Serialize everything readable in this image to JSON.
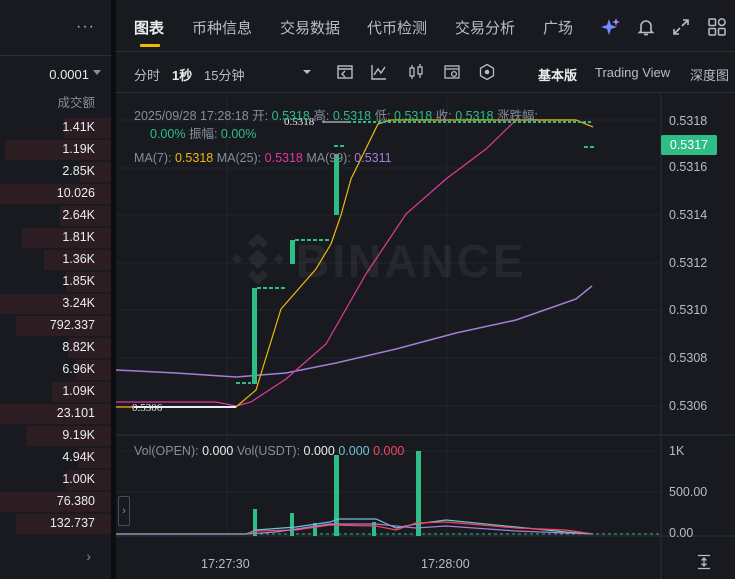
{
  "orderbook": {
    "menu_glyph": "···",
    "precision": "0.0001",
    "volume_header": "成交额",
    "rows": [
      "1.41K",
      "1.19K",
      "2.85K",
      "10.026",
      "2.64K",
      "1.81K",
      "1.36K",
      "1.85K",
      "3.24K",
      "792.337",
      "8.82K",
      "6.96K",
      "1.09K",
      "23.101",
      "9.19K",
      "4.94K",
      "1.00K",
      "76.380",
      "132.737"
    ],
    "more_glyph": "›"
  },
  "tabs": [
    "图表",
    "币种信息",
    "交易数据",
    "代币检测",
    "交易分析",
    "广场"
  ],
  "active_tab": "图表",
  "header_icons": [
    "ai-sparkle-icon",
    "bell-icon",
    "fullscreen-icon",
    "grid-icon"
  ],
  "toolbar": {
    "intervals": [
      "分时",
      "1秒",
      "15分钟"
    ],
    "active_interval": "1秒",
    "views": [
      "基本版",
      "Trading View",
      "深度图"
    ],
    "active_view": "基本版"
  },
  "ohlc": {
    "datetime": "2025/09/28 17:28:18",
    "open_label": "开:",
    "open": "0.5318",
    "high_label": "高:",
    "high": "0.5318",
    "low_label": "低:",
    "low": "0.5318",
    "close_label": "收:",
    "close": "0.5318",
    "change_label": "涨跌幅:",
    "change": "0.00%",
    "amplitude_label": "振幅:",
    "amplitude": "0.00%"
  },
  "ma": {
    "ma7_label": "MA(7):",
    "ma7": "0.5318",
    "ma25_label": "MA(25):",
    "ma25": "0.5318",
    "ma99_label": "MA(99):",
    "ma99": "0.5311"
  },
  "vol": {
    "open_label": "Vol(OPEN):",
    "open_value": "0.000",
    "usdt_label": "Vol(USDT):",
    "usdt_value": "0.000",
    "usdt_value2": "0.000",
    "usdt_value3": "0.000"
  },
  "current_price": "0.5317",
  "price_axis": [
    "0.5318",
    "0.5316",
    "0.5314",
    "0.5312",
    "0.5310",
    "0.5308",
    "0.5306"
  ],
  "volume_axis": [
    "1K",
    "500.00",
    "0.00"
  ],
  "time_axis": [
    "17:27:30",
    "17:28:00"
  ],
  "marker_high": "0.5318",
  "marker_low": "0.5306",
  "watermark": "BINANCE",
  "colors": {
    "up": "#2ebd85",
    "down": "#f6465d",
    "ma7": "#f0b90b",
    "ma25": "#e0399b",
    "ma99": "#a57fd6",
    "accent": "#f0b90b"
  }
}
